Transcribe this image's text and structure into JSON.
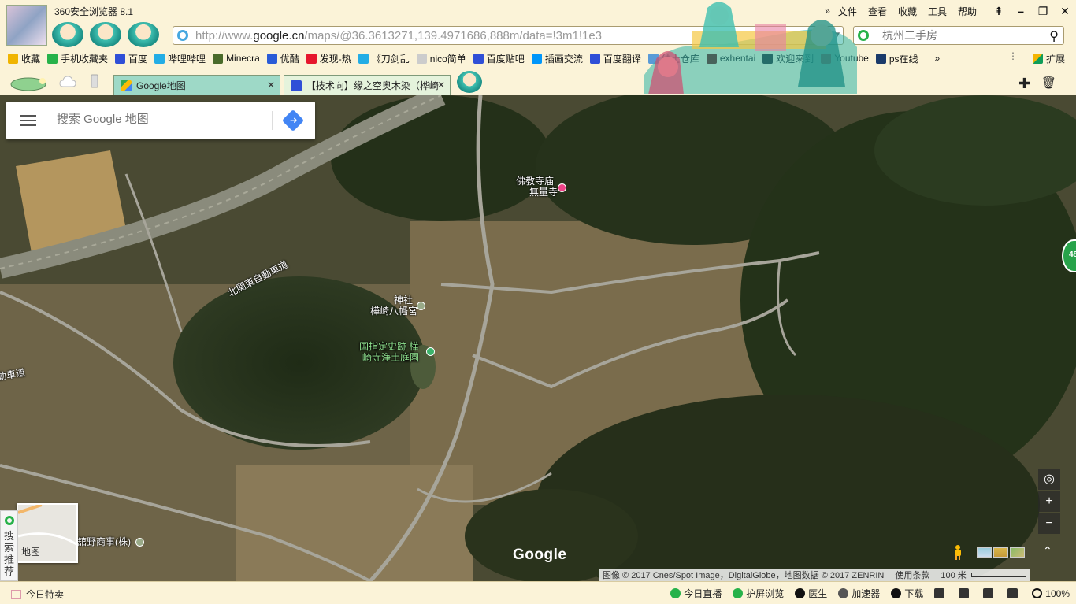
{
  "browser": {
    "title": "360安全浏览器 8.1",
    "menu": [
      "文件",
      "查看",
      "收藏",
      "工具",
      "帮助"
    ],
    "menu_chevron": "»",
    "window_buttons": {
      "pin": "⇞",
      "minimize": "–",
      "maximize": "❐",
      "close": "✕"
    },
    "address": {
      "prefix": "http://www.",
      "host": "google.cn",
      "path": "/maps/@36.3613271,139.4971686,888m/data=!3m1!1e3"
    },
    "search_placeholder": "杭州二手房"
  },
  "bookmarks": {
    "items": [
      {
        "label": "收藏",
        "icon": "star-icon",
        "color": "#f0b400"
      },
      {
        "label": "手机收藏夹",
        "icon": "phone-icon",
        "color": "#27b24a"
      },
      {
        "label": "百度",
        "icon": "paw-icon",
        "color": "#2f4fd7"
      },
      {
        "label": "哔哩哔哩",
        "icon": "tv-icon",
        "color": "#23ade5"
      },
      {
        "label": "Minecra",
        "icon": "globe-icon",
        "color": "#4a6b2a"
      },
      {
        "label": "优酷",
        "icon": "play-icon",
        "color": "#2a5bd7"
      },
      {
        "label": "发现-热",
        "icon": "weibo-icon",
        "color": "#e6162d"
      },
      {
        "label": "《刀剑乱",
        "icon": "tv-icon",
        "color": "#23ade5"
      },
      {
        "label": "nico简单",
        "icon": "page-icon",
        "color": "#cccccc"
      },
      {
        "label": "百度贴吧",
        "icon": "paw-icon",
        "color": "#2f4fd7"
      },
      {
        "label": "插画交流",
        "icon": "pixiv-icon",
        "color": "#0096fa"
      },
      {
        "label": "百度翻译",
        "icon": "translate-icon",
        "color": "#2f4fd7"
      },
      {
        "label": "绅士仓库",
        "icon": "box-icon",
        "color": "#5a9bd7"
      },
      {
        "label": "exhentai",
        "icon": "eh-icon",
        "color": "#660000"
      },
      {
        "label": "欢迎来到",
        "icon": "steam-icon",
        "color": "#171a21"
      },
      {
        "label": "Youtube",
        "icon": "youtube-icon",
        "color": "#e62117"
      },
      {
        "label": "ps在线",
        "icon": "ps-icon",
        "color": "#1a3a6a"
      }
    ],
    "more": "»",
    "extensions_label": "扩展",
    "extensions_dots": "⋮"
  },
  "tabs": [
    {
      "label": "Google地图",
      "active": true,
      "icon": "google-maps-icon"
    },
    {
      "label": "【技术向】缘之空奥木染（桦崎",
      "active": false,
      "icon": "paw-icon"
    }
  ],
  "map": {
    "search_placeholder": "搜索 Google 地图",
    "labels": {
      "highway": "北関東自動車道",
      "highway2": "動車道",
      "temple_type": "佛教寺庙",
      "temple_name": "無量寺",
      "shrine_type": "神社",
      "shrine_name": "樺崎八幡宮",
      "park_line1": "国指定史跡 樺",
      "park_line2": "崎寺浄土庭園",
      "company": "舘野商事(株)"
    },
    "badge": "48",
    "minimap_label": "地图",
    "side_promo": "搜索推荐",
    "google_logo": "Google",
    "attribution": "图像 © 2017 Cnes/Spot Image，DigitalGlobe，地图数据 © 2017 ZENRIN",
    "terms": "使用条款",
    "scale": "100 米",
    "controls": {
      "locate": "◎",
      "zoom_in": "+",
      "zoom_out": "−",
      "expand": "⌃"
    }
  },
  "status": {
    "today_sale": "今日特卖",
    "items": [
      {
        "label": "今日直播",
        "icon": "play-circle-icon",
        "color": "#27b24a"
      },
      {
        "label": "护屏浏览",
        "icon": "phone-icon",
        "color": "#27b24a"
      },
      {
        "label": "医生",
        "icon": "doctor-icon",
        "color": "#111111"
      },
      {
        "label": "加速器",
        "icon": "rocket-icon",
        "color": "#555555"
      },
      {
        "label": "下载",
        "icon": "download-icon",
        "color": "#111111"
      }
    ],
    "zoom": "100%"
  }
}
